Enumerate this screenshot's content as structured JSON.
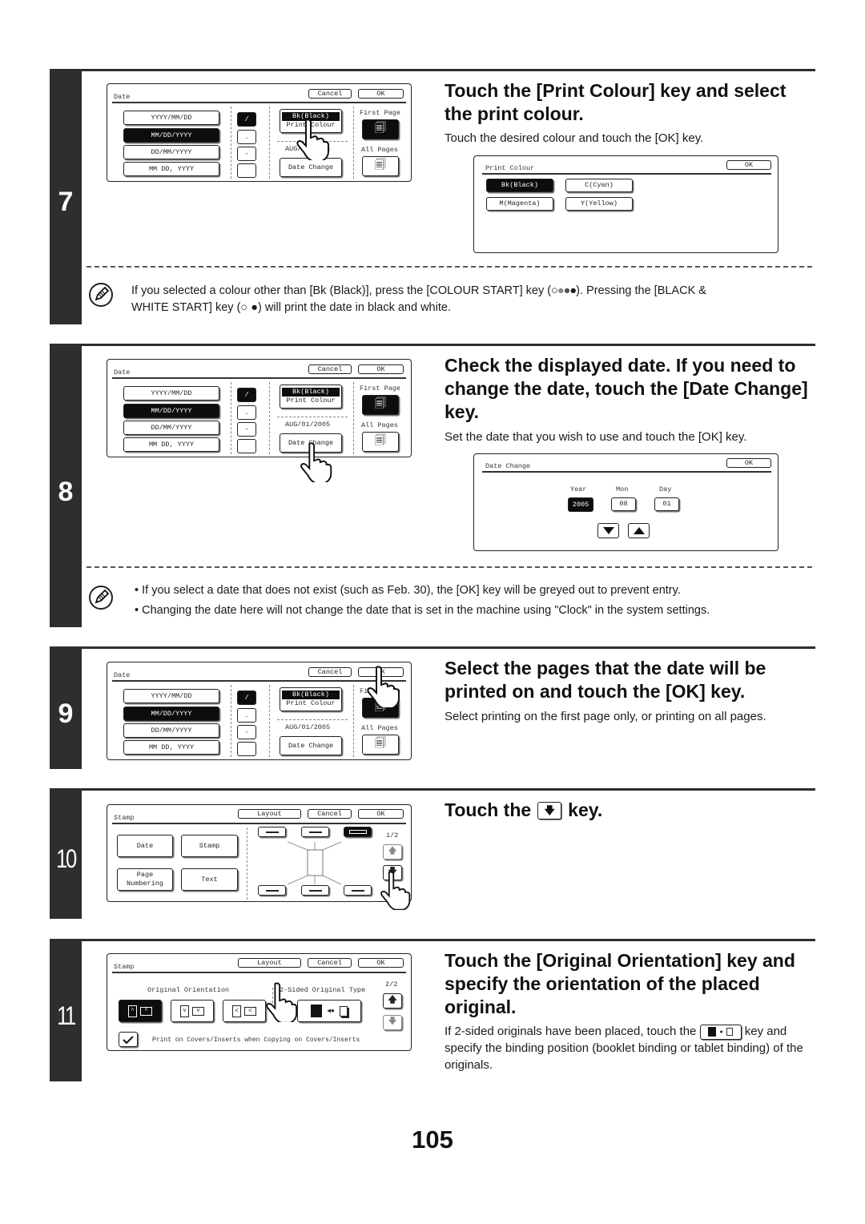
{
  "page_number": "105",
  "steps": [
    {
      "number": "7",
      "heading": "Touch the [Print Colour] key and select the print colour.",
      "description": "Touch the desired colour and touch the [OK] key.",
      "note": "If you selected a colour other than [Bk (Black)], press the [COLOUR START] key (○●●●). Pressing the [BLACK & WHITE START] key (○ ●) will print the date in black and white.",
      "note_line1": "If you selected a colour other than [Bk (Black)], press the [COLOUR START] key (",
      "note_line1_end": "). Pressing the [BLACK &",
      "note_line2_a": "WHITE START] key (",
      "note_line2_b": ") will print the date in black and white."
    },
    {
      "number": "8",
      "heading": "Check the displayed date. If you need to change the date, touch the [Date Change] key.",
      "description": "Set the date that you wish to use and touch the [OK] key.",
      "notes": [
        "If you select a date that does not exist (such as Feb. 30), the [OK] key will be greyed out to prevent entry.",
        "Changing the date here will not change the date that is set in the machine using \"Clock\" in the system settings."
      ]
    },
    {
      "number": "9",
      "heading": "Select the pages that the date will be printed on and touch the [OK] key.",
      "description": "Select printing on the first page only, or printing on all pages."
    },
    {
      "number": "10",
      "heading_before": "Touch the",
      "heading_after": "key.",
      "heading_key_icon": "down-arrow-icon"
    },
    {
      "number": "11",
      "heading": "Touch the [Original Orientation] key and specify the orientation of the placed original.",
      "description_before": "If 2-sided originals have been placed, touch the",
      "description_after": "key and specify the binding position (booklet binding or tablet binding) of the originals."
    }
  ],
  "date_screen": {
    "title": "Date",
    "cancel": "Cancel",
    "ok": "OK",
    "formats": [
      "YYYY/MM/DD",
      "MM/DD/YYYY",
      "DD/MM/YYYY",
      "MM DD, YYYY"
    ],
    "selected_format": "MM/DD/YYYY",
    "separators": [
      "/",
      ".",
      "-",
      ""
    ],
    "selected_separator": "/",
    "print_colour_value": "Bk(Black)",
    "print_colour_label": "Print Colour",
    "date_value": "AUG/01/2005",
    "date_change": "Date Change",
    "first_page": "First Page",
    "all_pages": "All Pages",
    "selected_pages": "First Page"
  },
  "print_colour_screen": {
    "title": "Print Colour",
    "ok": "OK",
    "colours": [
      "Bk(Black)",
      "C(Cyan)",
      "M(Magenta)",
      "Y(Yellow)"
    ],
    "selected": "Bk(Black)"
  },
  "date_change_screen": {
    "title": "Date Change",
    "ok": "OK",
    "year_label": "Year",
    "mon_label": "Mon",
    "day_label": "Day",
    "year": "2005",
    "mon": "08",
    "day": "01",
    "selected_field": "Year"
  },
  "stamp_screen_1": {
    "title": "Stamp",
    "layout": "Layout",
    "cancel": "Cancel",
    "ok": "OK",
    "buttons": [
      "Date",
      "Stamp",
      "Page\nNumbering",
      "Text"
    ],
    "page_indicator": "1/2",
    "selected_position": "top-right"
  },
  "stamp_screen_2": {
    "title": "Stamp",
    "layout": "Layout",
    "cancel": "Cancel",
    "ok": "OK",
    "original_orientation": "Original Orientation",
    "two_sided_type": "2-Sided Original Type",
    "page_indicator": "2/2",
    "checkbox_label": "Print on Covers/Inserts when Copying on Covers/Inserts",
    "checkbox_checked": true
  }
}
